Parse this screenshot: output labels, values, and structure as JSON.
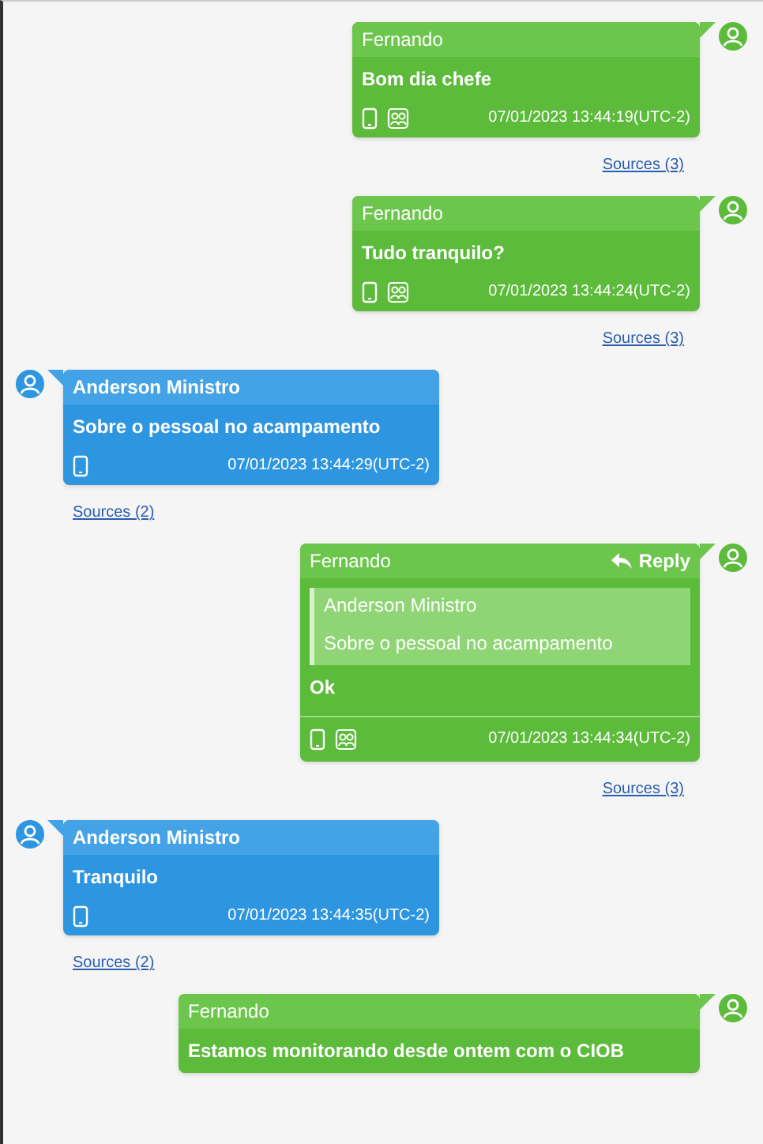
{
  "messages": [
    {
      "kind": "outgoing",
      "sender": "Fernando",
      "text": "Bom dia chefe",
      "timestamp": "07/01/2023 13:44:19(UTC-2)",
      "sources": "Sources (3)"
    },
    {
      "kind": "outgoing",
      "sender": "Fernando",
      "text": "Tudo tranquilo?",
      "timestamp": "07/01/2023 13:44:24(UTC-2)",
      "sources": "Sources (3)"
    },
    {
      "kind": "incoming",
      "sender": "Anderson Ministro",
      "text": "Sobre o pessoal no acampamento",
      "timestamp": "07/01/2023 13:44:29(UTC-2)",
      "sources": "Sources (2)"
    },
    {
      "kind": "outgoing",
      "sender": "Fernando",
      "reply_label": "Reply",
      "quote": {
        "sender": "Anderson Ministro",
        "text": "Sobre o pessoal no acampamento"
      },
      "text": "Ok",
      "timestamp": "07/01/2023 13:44:34(UTC-2)",
      "sources": "Sources (3)"
    },
    {
      "kind": "incoming",
      "sender": "Anderson Ministro",
      "text": "Tranquilo",
      "timestamp": "07/01/2023 13:44:35(UTC-2)",
      "sources": "Sources (2)"
    },
    {
      "kind": "outgoing",
      "sender": "Fernando",
      "text": "Estamos monitorando desde ontem com o CIOB"
    }
  ]
}
